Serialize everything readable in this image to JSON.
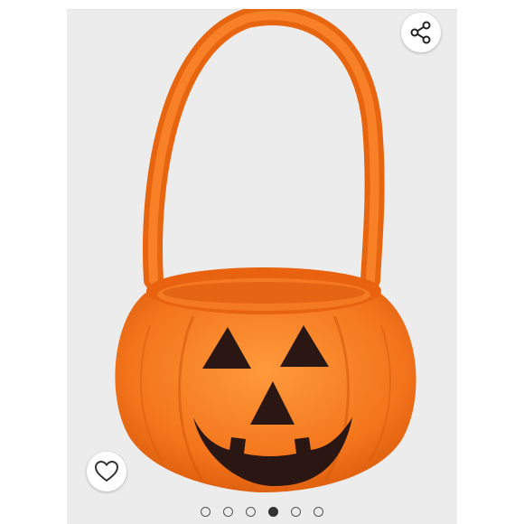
{
  "carousel": {
    "slide_count": 6,
    "active_index": 3
  },
  "image": {
    "subject": "pumpkin-basket"
  },
  "icons": {
    "share": "share-icon",
    "like": "heart-icon"
  },
  "colors": {
    "backdrop": "#ececec",
    "pumpkin": "#f37a1f",
    "face": "#2a1612",
    "dot_active": "#333333"
  }
}
